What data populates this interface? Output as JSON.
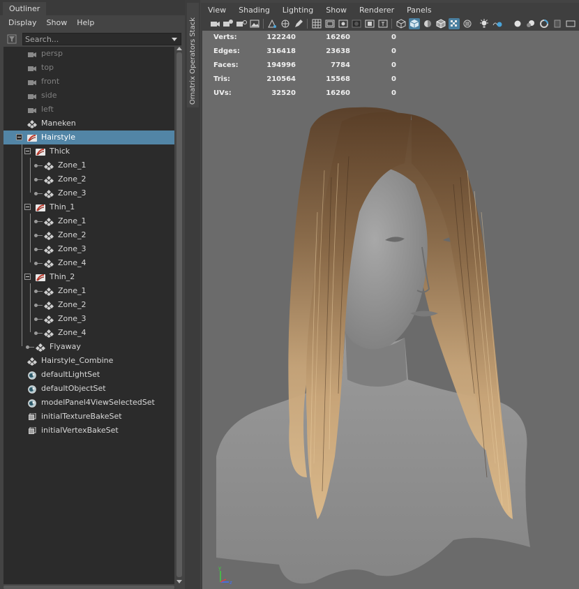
{
  "outliner": {
    "tab_title": "Outliner",
    "menu": [
      "Display",
      "Show",
      "Help"
    ],
    "search_placeholder": "Search...",
    "items": [
      {
        "label": "persp",
        "icon": "camera-icon"
      },
      {
        "label": "top",
        "icon": "camera-icon"
      },
      {
        "label": "front",
        "icon": "camera-icon"
      },
      {
        "label": "side",
        "icon": "camera-icon"
      },
      {
        "label": "left",
        "icon": "camera-icon"
      },
      {
        "label": "Maneken",
        "icon": "transform-icon"
      },
      {
        "label": "Hairstyle",
        "icon": "ornatrix-icon"
      },
      {
        "label": "Thick",
        "icon": "ornatrix-icon"
      },
      {
        "label": "Zone_1",
        "icon": "transform-icon"
      },
      {
        "label": "Zone_2",
        "icon": "transform-icon"
      },
      {
        "label": "Zone_3",
        "icon": "transform-icon"
      },
      {
        "label": "Thin_1",
        "icon": "ornatrix-icon"
      },
      {
        "label": "Zone_1",
        "icon": "transform-icon"
      },
      {
        "label": "Zone_2",
        "icon": "transform-icon"
      },
      {
        "label": "Zone_3",
        "icon": "transform-icon"
      },
      {
        "label": "Zone_4",
        "icon": "transform-icon"
      },
      {
        "label": "Thin_2",
        "icon": "ornatrix-icon"
      },
      {
        "label": "Zone_1",
        "icon": "transform-icon"
      },
      {
        "label": "Zone_2",
        "icon": "transform-icon"
      },
      {
        "label": "Zone_3",
        "icon": "transform-icon"
      },
      {
        "label": "Zone_4",
        "icon": "transform-icon"
      },
      {
        "label": "Flyaway",
        "icon": "transform-icon"
      },
      {
        "label": "Hairstyle_Combine",
        "icon": "transform-icon"
      },
      {
        "label": "defaultLightSet",
        "icon": "set-icon"
      },
      {
        "label": "defaultObjectSet",
        "icon": "set-icon"
      },
      {
        "label": "modelPanel4ViewSelectedSet",
        "icon": "set-icon"
      },
      {
        "label": "initialTextureBakeSet",
        "icon": "bake-set-icon"
      },
      {
        "label": "initialVertexBakeSet",
        "icon": "bake-set-icon"
      }
    ],
    "selected_item": "Hairstyle"
  },
  "side_tab": {
    "label": "Ornatrix Operators Stack"
  },
  "viewport": {
    "menu": [
      "View",
      "Shading",
      "Lighting",
      "Show",
      "Renderer",
      "Panels"
    ],
    "hud": [
      {
        "label": "Verts:",
        "v1": "122240",
        "v2": "16260",
        "v3": "0"
      },
      {
        "label": "Edges:",
        "v1": "316418",
        "v2": "23638",
        "v3": "0"
      },
      {
        "label": "Faces:",
        "v1": "194996",
        "v2": "7784",
        "v3": "0"
      },
      {
        "label": "Tris:",
        "v1": "210564",
        "v2": "15568",
        "v3": "0"
      },
      {
        "label": "UVs:",
        "v1": "32520",
        "v2": "16260",
        "v3": "0"
      }
    ],
    "axis": {
      "y": "y",
      "z": "z"
    }
  },
  "colors": {
    "selection": "#5285a6",
    "viewport_bg": "#6b6b6b",
    "hair_root": "#5a3f28",
    "hair_tip": "#d9b88a"
  }
}
